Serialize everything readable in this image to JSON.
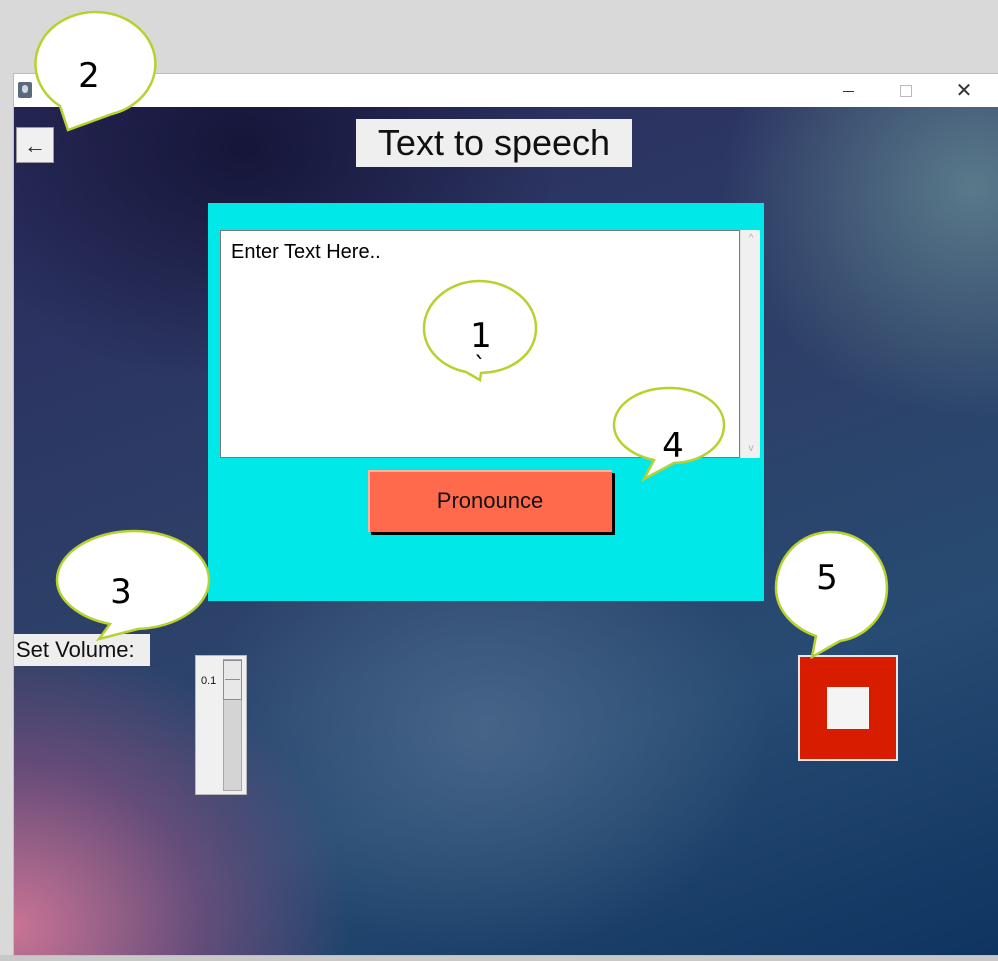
{
  "window": {
    "title": "",
    "controls": {
      "minimize": "–",
      "maximize": "□",
      "close": "✕"
    }
  },
  "header": {
    "back_label": "←",
    "title": "Text to speech"
  },
  "input_panel": {
    "text_value": "Enter Text Here..",
    "pronounce_label": "Pronounce",
    "scroll_up": "^",
    "scroll_down": "v"
  },
  "volume": {
    "label": "Set Volume:",
    "value": "0.1"
  },
  "stop_button": {
    "icon": "stop-icon"
  },
  "annotations": [
    {
      "id": "1",
      "label": "1",
      "extra_mark": "`"
    },
    {
      "id": "2",
      "label": "2"
    },
    {
      "id": "3",
      "label": "3"
    },
    {
      "id": "4",
      "label": "4"
    },
    {
      "id": "5",
      "label": "5"
    }
  ],
  "colors": {
    "panel": "#00e8e8",
    "pronounce": "#ff6a4d",
    "stop": "#d81c00",
    "bubble_fill": "#ffffff",
    "bubble_stroke": "#b5d22e"
  }
}
